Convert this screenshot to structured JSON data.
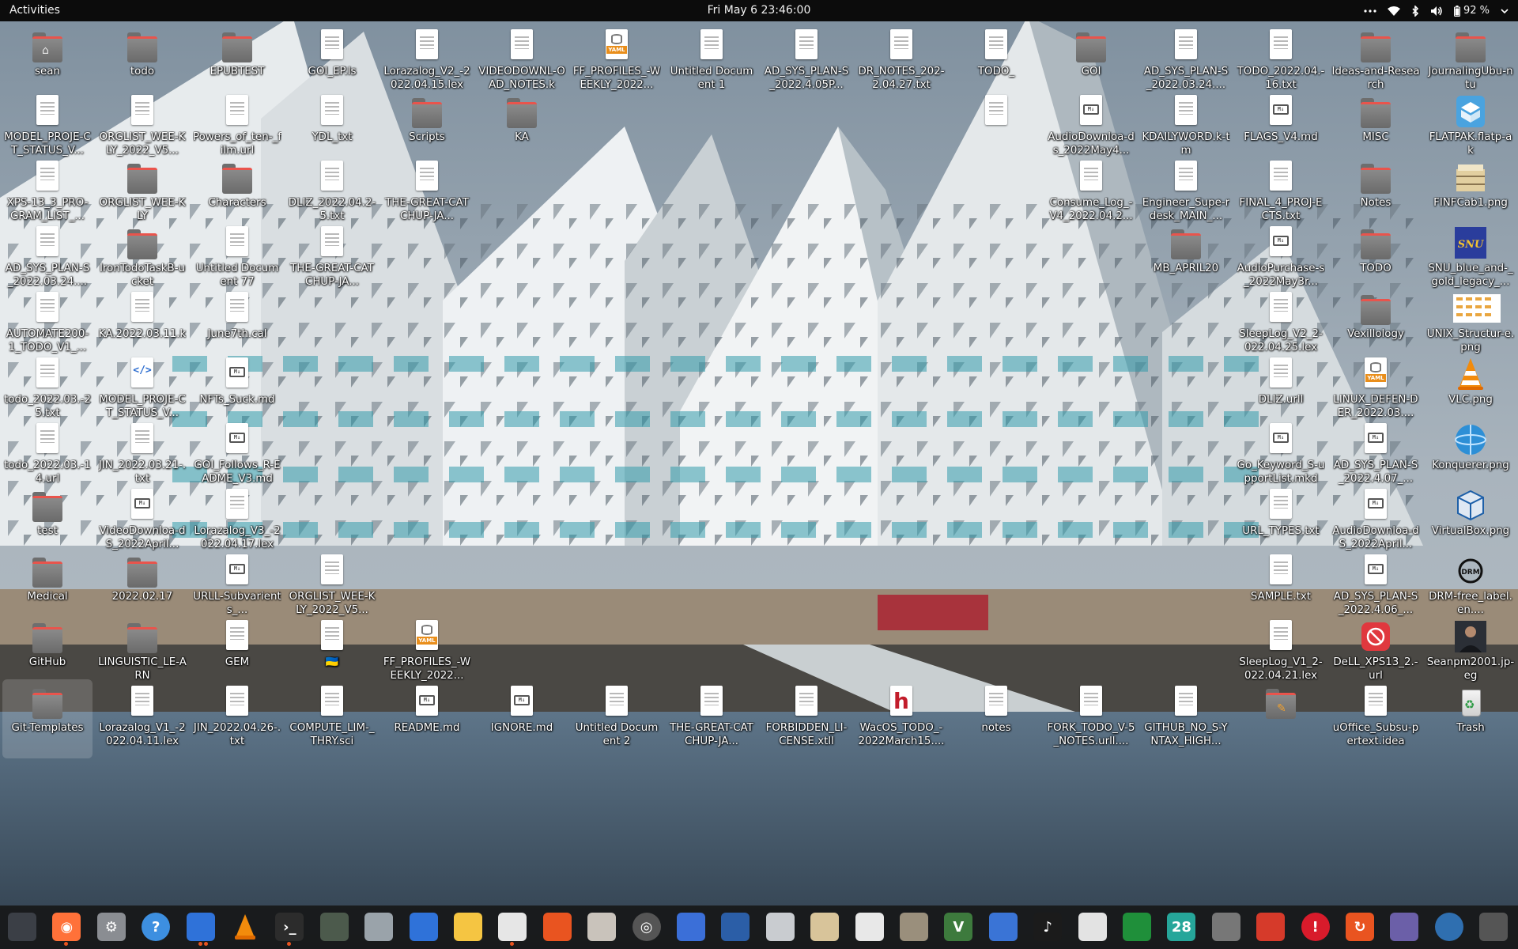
{
  "topbar": {
    "activities": "Activities",
    "clock": "Fri May 6  23:46:00",
    "battery": "92 %"
  },
  "desktop": {
    "icons": [
      [
        "sean",
        "ic-folder ic-home"
      ],
      [
        "todo",
        "ic-folder"
      ],
      [
        "EPUBTEST",
        "ic-folder"
      ],
      [
        "GOI_EP.ls",
        "ic-doc"
      ],
      [
        "Lorazalog_V2_-2022.04.15.lex",
        "ic-doc"
      ],
      [
        "VIDEODOWNL-OAD_NOTES.k",
        "ic-doc"
      ],
      [
        "FF_PROFILES_-WEEKLY_2022...",
        "ic-doc ic-yaml"
      ],
      [
        "Untitled Document 1",
        "ic-doc"
      ],
      [
        "AD_SYS_PLAN-S_2022.4.05P...",
        "ic-doc"
      ],
      [
        "DR_NOTES_202-2.04.27.txt",
        "ic-doc"
      ],
      [
        "TODO_",
        "ic-doc"
      ],
      [
        "GOI",
        "ic-folder"
      ],
      [
        "AD_SYS_PLAN-S_2022.03.24....",
        "ic-doc"
      ],
      [
        "TODO_2022.04.-16.txt",
        "ic-doc"
      ],
      [
        "Ideas-and-Research",
        "ic-folder"
      ],
      [
        "JournalingUbu-ntu",
        "ic-folder"
      ],
      [
        "MODEL_PROJE-CT_STATUS_V...",
        "ic-doc"
      ],
      [
        "ORGLIST_WEE-KLY_2022_V5...",
        "ic-doc"
      ],
      [
        "Powers_of_ten-_film.url",
        "ic-doc"
      ],
      [
        "YDL_txt",
        "ic-doc"
      ],
      [
        "Scripts",
        "ic-folder"
      ],
      [
        "KA",
        "ic-folder"
      ],
      null,
      null,
      null,
      null,
      [
        "",
        "ic-doc"
      ],
      [
        "AudioDownloa-ds_2022May4...",
        "ic-doc ic-md"
      ],
      [
        "KDAILYWORD.k-tm",
        "ic-doc"
      ],
      [
        "FLAGS_V4.md",
        "ic-doc ic-md"
      ],
      [
        "MISC",
        "ic-folder"
      ],
      [
        "FLATPAK.flatp-ak",
        "ic-img flatpak"
      ],
      [
        "XPS-13_3_PRO-GRAM_LIST_...",
        "ic-doc"
      ],
      [
        "ORGLIST_WEE-KLY",
        "ic-folder"
      ],
      [
        "Characters",
        "ic-folder"
      ],
      [
        "DLIZ_2022.04.2-5.txt",
        "ic-doc"
      ],
      [
        "THE-GREAT-CATCHUP-JA...",
        "ic-doc"
      ],
      null,
      null,
      null,
      null,
      null,
      null,
      [
        "Consume_Log_-V4_2022.04.2...",
        "ic-doc"
      ],
      [
        "Engineer_Supe-rdesk_MAIN_...",
        "ic-doc"
      ],
      [
        "FINAL_4_PROJ-ECTS.txt",
        "ic-doc"
      ],
      [
        "Notes",
        "ic-folder"
      ],
      [
        "FINFCab1.png",
        "ic-img cab"
      ],
      [
        "AD_SYS_PLAN-S_2022.03.24....",
        "ic-doc"
      ],
      [
        "IronTodoTaskB-ucket",
        "ic-folder"
      ],
      [
        "Untitled Document 77",
        "ic-doc"
      ],
      [
        "THE-GREAT-CATCHUP-JA...",
        "ic-doc"
      ],
      null,
      null,
      null,
      null,
      null,
      null,
      null,
      null,
      [
        "MB_APRIL20",
        "ic-folder"
      ],
      [
        "AudioPurchase-s_2022May3r...",
        "ic-doc ic-md"
      ],
      [
        "TODO",
        "ic-folder"
      ],
      [
        "SNU_blue_and-_gold_legacy_...",
        "ic-img snu"
      ],
      [
        "AUTOMATE200-1_TODO_V1_...",
        "ic-doc"
      ],
      [
        "KA.2022.03.11.k",
        "ic-doc"
      ],
      [
        "June7th.cal",
        "ic-doc"
      ],
      null,
      null,
      null,
      null,
      null,
      null,
      null,
      null,
      null,
      null,
      [
        "SleepLog_V2_2-022.04.25.lex",
        "ic-doc"
      ],
      [
        "Vexillology",
        "ic-folder"
      ],
      [
        "UNIX_Structur-e.png",
        "ic-img unix"
      ],
      [
        "todo_2022.03.-25.txt",
        "ic-doc"
      ],
      [
        "MODEL_PROJE-CT_STATUS_V...",
        "ic-doc ic-html"
      ],
      [
        "NFTs_Suck.md",
        "ic-doc ic-md"
      ],
      null,
      null,
      null,
      null,
      null,
      null,
      null,
      null,
      null,
      null,
      [
        "DLIZ.urll",
        "ic-doc"
      ],
      [
        "LINUX_DEFEN-DER_2022.03....",
        "ic-doc ic-yaml"
      ],
      [
        "VLC.png",
        "ic-img vlc"
      ],
      [
        "todo_2022.03.-14.url",
        "ic-doc"
      ],
      [
        "JIN_2022.03.21-.txt",
        "ic-doc"
      ],
      [
        "GOI_Follows_R-EADME_V3.md",
        "ic-doc ic-md"
      ],
      null,
      null,
      null,
      null,
      null,
      null,
      null,
      null,
      null,
      null,
      [
        "Go_Keyword_S-upportList.mkd",
        "ic-doc ic-md"
      ],
      [
        "AD_SYS_PLAN-S_2022.4.07_...",
        "ic-doc ic-md"
      ],
      [
        "Konquerer.png",
        "ic-img konq"
      ],
      [
        "test",
        "ic-folder"
      ],
      [
        "VideoDownloa-dS_2022April...",
        "ic-doc ic-md"
      ],
      [
        "Lorazalog_V3_-2022.04.17.lex",
        "ic-doc"
      ],
      null,
      null,
      null,
      null,
      null,
      null,
      null,
      null,
      null,
      null,
      [
        "URL_TYPES.txt",
        "ic-doc"
      ],
      [
        "AudioDownloa-dS_2022April...",
        "ic-doc ic-md"
      ],
      [
        "VirtualBox.png",
        "ic-img vbox"
      ],
      [
        "Medical",
        "ic-folder"
      ],
      [
        "2022.02.17",
        "ic-folder"
      ],
      [
        "URLL-Subvarients_...",
        "ic-doc ic-md"
      ],
      [
        "ORGLIST_WEE-KLY_2022_V5...",
        "ic-doc"
      ],
      null,
      null,
      null,
      null,
      null,
      null,
      null,
      null,
      null,
      [
        "SAMPLE.txt",
        "ic-doc"
      ],
      [
        "AD_SYS_PLAN-S_2022.4.06_...",
        "ic-doc ic-md"
      ],
      [
        "DRM-free_label.en....",
        "ic-img drm"
      ],
      [
        "GitHub",
        "ic-folder"
      ],
      [
        "LINGUISTIC_LE-ARN",
        "ic-folder"
      ],
      [
        "GEM",
        "ic-doc"
      ],
      [
        "🇺🇦",
        "ic-doc"
      ],
      [
        "FF_PROFILES_-WEEKLY_2022...",
        "ic-doc ic-yaml"
      ],
      null,
      null,
      null,
      null,
      null,
      null,
      null,
      null,
      [
        "SleepLog_V1_2-022.04.21.lex",
        "ic-doc"
      ],
      [
        "DeLL_XPS13_2.-url",
        "ic-img dell"
      ],
      [
        "Seanpm2001.jp-eg",
        "ic-img photo"
      ],
      [
        "Git-Templates",
        "ic-folder"
      ],
      [
        "Lorazalog_V1_-2022.04.11.lex",
        "ic-doc"
      ],
      [
        "JIN_2022.04.26-.txt",
        "ic-doc"
      ],
      [
        "COMPUTE_LIM-_THRY.sci",
        "ic-doc"
      ],
      [
        "README.md",
        "ic-doc ic-md"
      ],
      [
        "IGNORE.md",
        "ic-doc ic-md"
      ],
      [
        "Untitled Document 2",
        "ic-doc"
      ],
      [
        "THE-GREAT-CATCHUP-JA...",
        "ic-doc"
      ],
      [
        "FORBIDDEN_LI-CENSE.xtll",
        "ic-doc"
      ],
      [
        "WacOS_TODO_-2022March15....",
        "ic-doc ic-h"
      ],
      [
        "notes",
        "ic-doc"
      ],
      [
        "FORK_TODO_V-5_NOTES.urll....",
        "ic-doc"
      ],
      [
        "GITHUB_NO_S-YNTAX_HIGH...",
        "ic-doc"
      ],
      [
        "",
        "ic-folder pencil"
      ],
      [
        "uOffice_Subsu-pertext.idea",
        "ic-doc"
      ],
      [
        "Trash",
        "ic-trash"
      ]
    ]
  },
  "dock": {
    "items": [
      "system-monitor",
      "firefox",
      "settings",
      "help",
      "text-document",
      "vlc",
      "terminal",
      "archive",
      "search",
      "text-editor",
      "calculator",
      "chart",
      "software-center",
      "files",
      "disc",
      "checklist",
      "books",
      "calendar-reader",
      "package",
      "spreadsheet-a",
      "archive-b",
      "vim",
      "virtual-desktop",
      "music",
      "pdf",
      "spreadsheet",
      "calendar-28",
      "tools",
      "mario",
      "error",
      "update",
      "screenshot",
      "remote",
      "unity",
      "app-grid"
    ],
    "calendar_day": "28",
    "vim_label": "V",
    "help_label": "?"
  },
  "colors": {
    "topbar": "#0c0c0c",
    "accent": "#e95420",
    "folder": "#7a7a7a",
    "folder_tab": "#e9544c"
  }
}
